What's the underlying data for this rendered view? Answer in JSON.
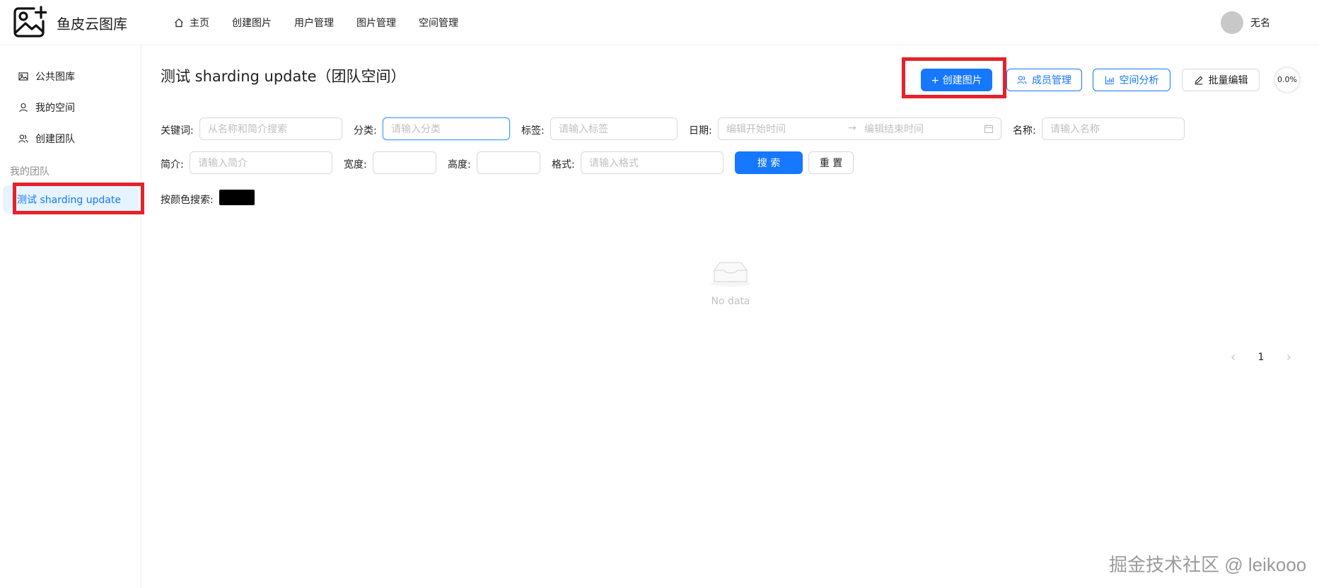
{
  "app": {
    "title": "鱼皮云图库"
  },
  "nav": {
    "items": [
      {
        "label": "主页"
      },
      {
        "label": "创建图片"
      },
      {
        "label": "用户管理"
      },
      {
        "label": "图片管理"
      },
      {
        "label": "空间管理"
      }
    ]
  },
  "user": {
    "name": "无名"
  },
  "sidebar": {
    "items": [
      {
        "label": "公共图库",
        "icon": "picture-icon"
      },
      {
        "label": "我的空间",
        "icon": "user-icon"
      },
      {
        "label": "创建团队",
        "icon": "team-icon"
      }
    ],
    "group_label": "我的团队",
    "team_items": [
      {
        "label": "测试 sharding update"
      }
    ]
  },
  "page": {
    "title": "测试 sharding update（团队空间）",
    "buttons": {
      "create": "+ 创建图片",
      "members": "成员管理",
      "analysis": "空间分析",
      "batch_edit": "批量编辑"
    },
    "usage_percent": "0.0%"
  },
  "search": {
    "keyword_label": "关键词:",
    "keyword_placeholder": "从名称和简介搜索",
    "category_label": "分类:",
    "category_placeholder": "请输入分类",
    "tag_label": "标签:",
    "tag_placeholder": "请输入标签",
    "date_label": "日期:",
    "date_start_placeholder": "编辑开始时间",
    "date_end_placeholder": "编辑结束时间",
    "name_label": "名称:",
    "name_placeholder": "请输入名称",
    "intro_label": "简介:",
    "intro_placeholder": "请输入简介",
    "width_label": "宽度:",
    "height_label": "高度:",
    "format_label": "格式:",
    "format_placeholder": "请输入格式",
    "search_button": "搜 索",
    "reset_button": "重 置",
    "color_label": "按颜色搜索:",
    "color_value": "#000000"
  },
  "empty": {
    "text": "No data"
  },
  "pagination": {
    "current": "1"
  },
  "watermark": "掘金技术社区 @ leikooo",
  "colors": {
    "primary": "#1677ff",
    "highlight": "#e5222a"
  }
}
